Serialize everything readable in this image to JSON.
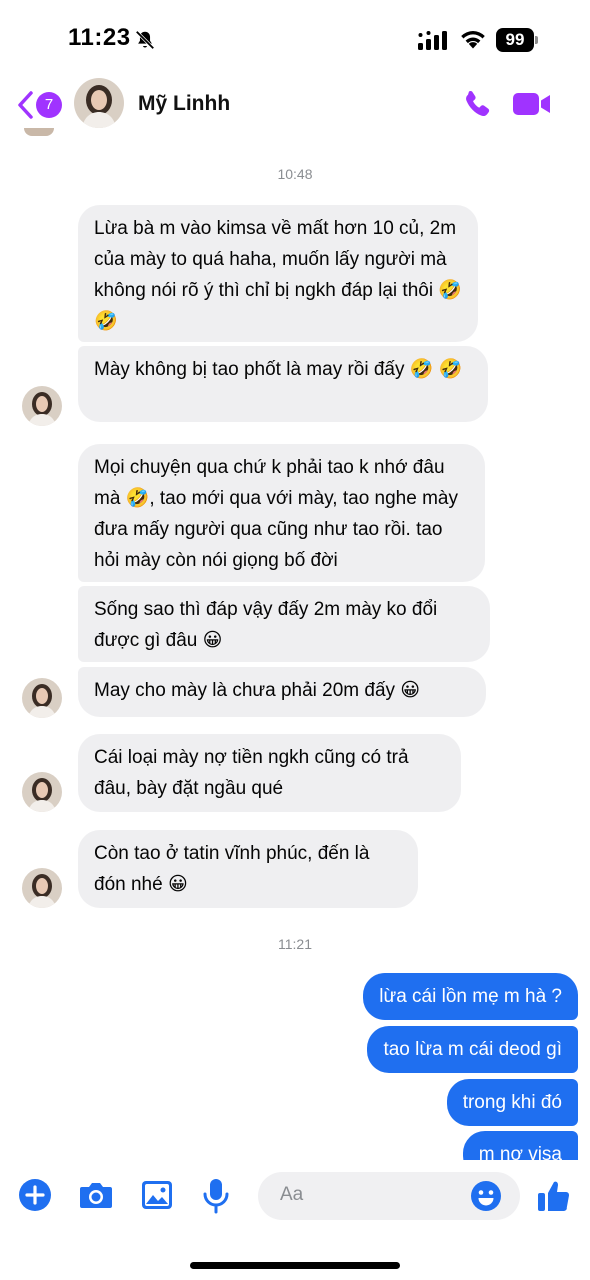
{
  "status_bar": {
    "time": "11:23",
    "battery": "99"
  },
  "header": {
    "back_badge": "7",
    "contact_name": "Mỹ Linhh"
  },
  "timestamps": [
    "10:48",
    "11:21"
  ],
  "incoming_messages": [
    "Lừa bà m vào kimsa về mất hơn 10 củ, 2m của mày to quá haha, muốn lấy người mà không nói rõ ý thì chỉ bị ngkh đáp lại thôi 🤣🤣",
    "Mày không bị tao phốt là may rồi đấy 🤣 🤣",
    "Mọi chuyện qua chứ k phải tao k nhớ đâu mà 🤣, tao mới qua với mày, tao nghe mày đưa mấy người qua cũng như tao rồi. tao hỏi mày còn nói giọng bố đời",
    "Sống sao thì đáp vậy đấy 2m mày ko đổi được gì đâu 😀",
    "May cho mày là chưa phải 20m đấy 😀",
    "Cái loại mày nợ tiền ngkh cũng có trả đâu, bày đặt ngầu qué",
    "Còn tao ở tatin vĩnh phúc, đến là đón nhé 😀"
  ],
  "outgoing_messages": [
    "lừa cái lồn mẹ m hà ?",
    "tao lừa m cái deod gì",
    "trong khi đó",
    "m nợ visa"
  ],
  "composer": {
    "placeholder": "Aa"
  },
  "colors": {
    "accent": "#a033ff",
    "outgoing_bubble": "#1f6ff0",
    "incoming_bubble": "#efeff1"
  },
  "icons": [
    "bell-slash-icon",
    "signal-icon",
    "wifi-icon",
    "back-chevron-icon",
    "phone-icon",
    "video-icon",
    "plus-icon",
    "camera-icon",
    "gallery-icon",
    "mic-icon",
    "emoji-icon",
    "like-icon"
  ]
}
